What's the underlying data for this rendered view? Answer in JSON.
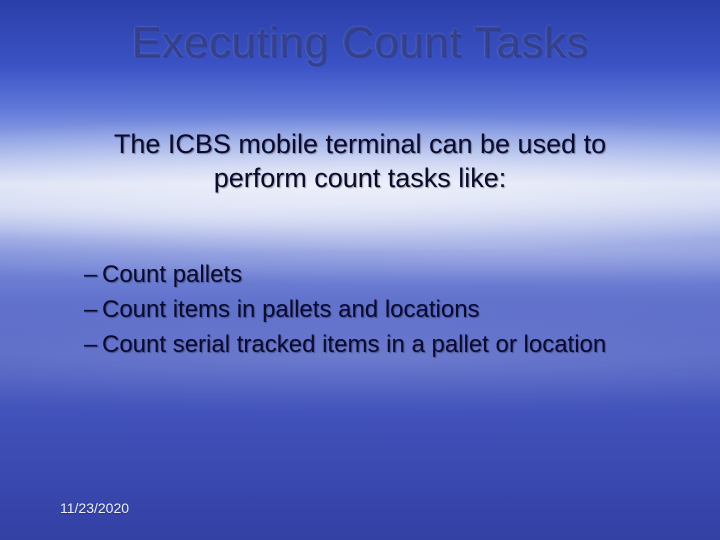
{
  "title": "Executing Count Tasks",
  "subtitle_line1": "The ICBS mobile terminal can be used to",
  "subtitle_line2": "perform count tasks like:",
  "bullets": {
    "dash": "–",
    "b1": "Count pallets",
    "b2": "Count items in pallets and locations",
    "b3": "Count serial tracked items in a pallet or location"
  },
  "footer_date": "11/23/2020"
}
